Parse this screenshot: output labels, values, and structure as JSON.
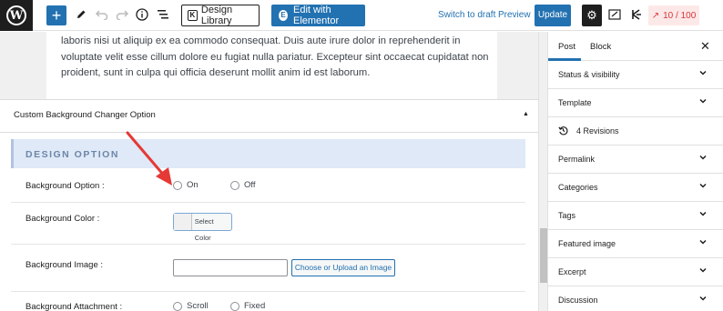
{
  "toolbar": {
    "design_library": "Design Library",
    "edit_elementor": "Edit with Elementor",
    "switch_to_draft": "Switch to draft",
    "preview": "Preview",
    "update": "Update",
    "score": "10 / 100"
  },
  "editor": {
    "paragraph": "laboris nisi ut aliquip ex ea commodo consequat. Duis aute irure dolor in reprehenderit in voluptate velit esse cillum dolore eu fugiat nulla pariatur. Excepteur sint occaecat cupidatat non proident, sunt in culpa qui officia deserunt mollit anim id est laborum."
  },
  "metabox": {
    "title": "Custom Background Changer Option",
    "section": "DESIGN OPTION",
    "background_option": {
      "label": "Background Option :",
      "on": "On",
      "off": "Off"
    },
    "background_color": {
      "label": "Background Color :",
      "button": "Select Color"
    },
    "background_image": {
      "label": "Background Image :",
      "value": "",
      "button": "Choose or Upload an Image"
    },
    "background_attachment": {
      "label": "Background Attachment :",
      "scroll": "Scroll",
      "fixed": "Fixed"
    }
  },
  "sidebar": {
    "tabs": [
      "Post",
      "Block"
    ],
    "panels": {
      "status": "Status & visibility",
      "template": "Template",
      "revisions": "4 Revisions",
      "permalink": "Permalink",
      "categories": "Categories",
      "tags": "Tags",
      "featured_image": "Featured image",
      "excerpt": "Excerpt",
      "discussion": "Discussion"
    }
  },
  "colors": {
    "accent": "#2271b1",
    "annotation_arrow": "#e53935",
    "design_header_bg": "#dfe9f7",
    "score_text": "#d63638"
  }
}
